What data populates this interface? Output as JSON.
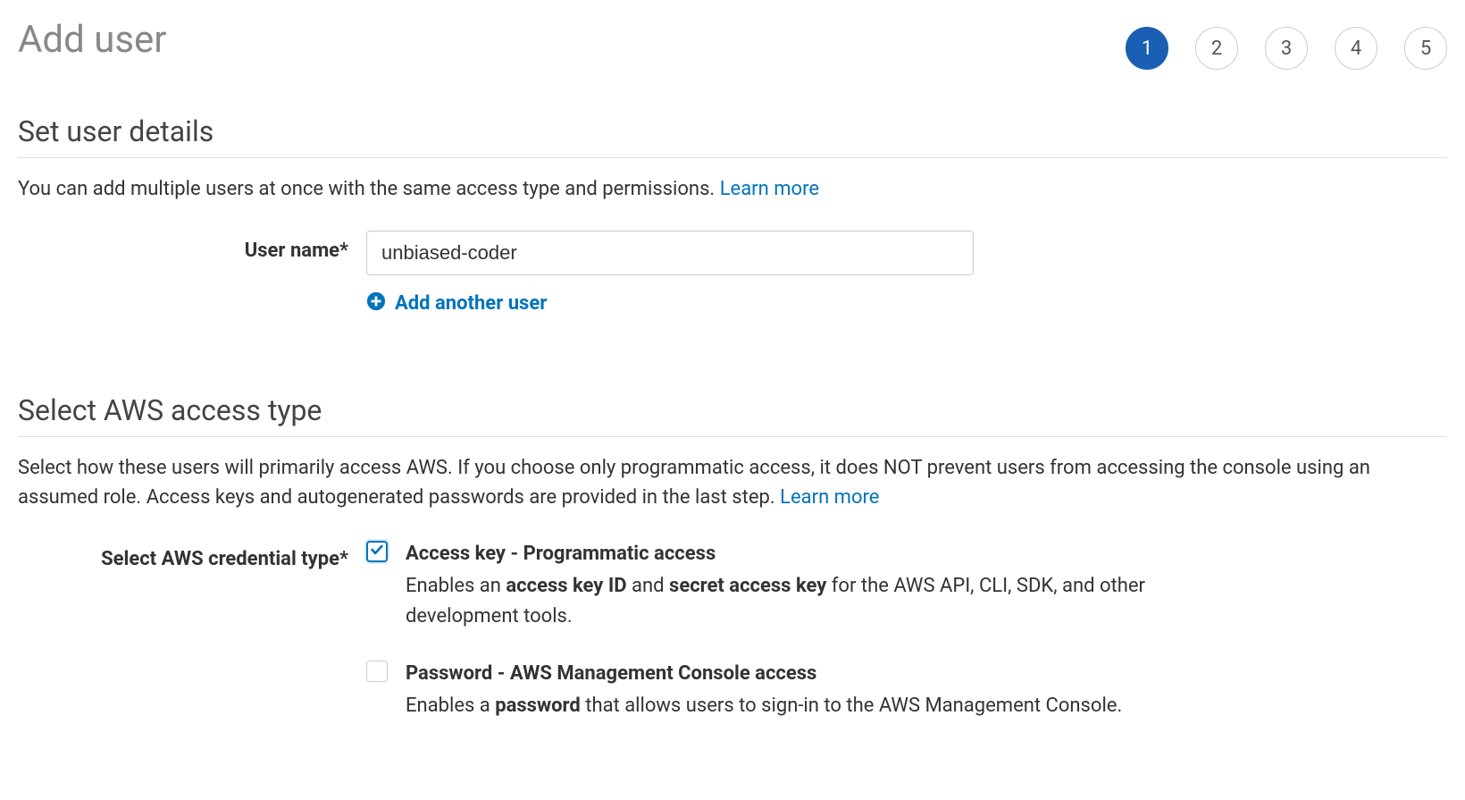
{
  "header": {
    "title": "Add user",
    "steps": [
      "1",
      "2",
      "3",
      "4",
      "5"
    ],
    "activeStep": 1
  },
  "userDetails": {
    "heading": "Set user details",
    "description": "You can add multiple users at once with the same access type and permissions. ",
    "learnMore": "Learn more",
    "userNameLabel": "User name*",
    "userNameValue": "unbiased-coder",
    "addAnother": "Add another user"
  },
  "accessType": {
    "heading": "Select AWS access type",
    "description": "Select how these users will primarily access AWS. If you choose only programmatic access, it does NOT prevent users from accessing the console using an assumed role. Access keys and autogenerated passwords are provided in the last step. ",
    "learnMore": "Learn more",
    "credentialTypeLabel": "Select AWS credential type*",
    "option1": {
      "checked": true,
      "title": "Access key - Programmatic access",
      "descPrefix": "Enables an ",
      "descBold1": "access key ID",
      "descMid": " and ",
      "descBold2": "secret access key",
      "descSuffix": " for the AWS API, CLI, SDK, and other development tools."
    },
    "option2": {
      "checked": false,
      "title": "Password - AWS Management Console access",
      "descPrefix": "Enables a ",
      "descBold1": "password",
      "descSuffix": " that allows users to sign-in to the AWS Management Console."
    }
  }
}
